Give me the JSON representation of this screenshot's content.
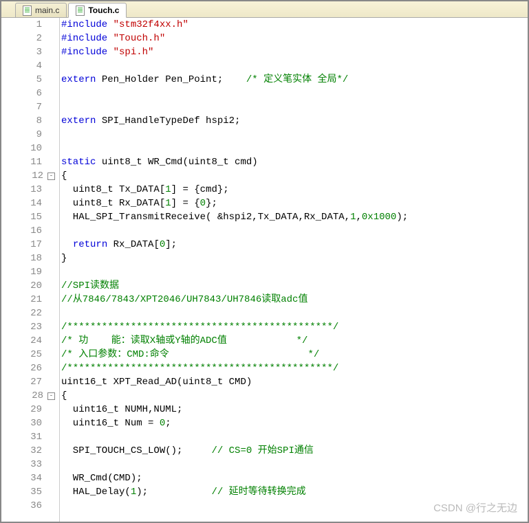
{
  "tabs": [
    {
      "name": "main.c",
      "active": false
    },
    {
      "name": "Touch.c",
      "active": true
    }
  ],
  "lines": [
    {
      "n": 1,
      "fold": null,
      "tokens": [
        [
          "kw",
          "#include "
        ],
        [
          "str",
          "\"stm32f4xx.h\""
        ]
      ]
    },
    {
      "n": 2,
      "fold": null,
      "tokens": [
        [
          "kw",
          "#include "
        ],
        [
          "str",
          "\"Touch.h\""
        ]
      ]
    },
    {
      "n": 3,
      "fold": null,
      "tokens": [
        [
          "kw",
          "#include "
        ],
        [
          "str",
          "\"spi.h\""
        ]
      ]
    },
    {
      "n": 4,
      "fold": null,
      "tokens": []
    },
    {
      "n": 5,
      "fold": null,
      "tokens": [
        [
          "kw",
          "extern"
        ],
        [
          "",
          " Pen_Holder Pen_Point;    "
        ],
        [
          "cmt",
          "/* 定义笔实体 全局*/"
        ]
      ]
    },
    {
      "n": 6,
      "fold": null,
      "tokens": []
    },
    {
      "n": 7,
      "fold": null,
      "tokens": []
    },
    {
      "n": 8,
      "fold": null,
      "tokens": [
        [
          "kw",
          "extern"
        ],
        [
          "",
          " SPI_HandleTypeDef hspi2;"
        ]
      ]
    },
    {
      "n": 9,
      "fold": null,
      "tokens": []
    },
    {
      "n": 10,
      "fold": null,
      "tokens": []
    },
    {
      "n": 11,
      "fold": null,
      "tokens": [
        [
          "kw",
          "static"
        ],
        [
          "",
          " uint8_t WR_Cmd(uint8_t cmd)"
        ]
      ]
    },
    {
      "n": 12,
      "fold": "-",
      "tokens": [
        [
          "",
          "{"
        ]
      ]
    },
    {
      "n": 13,
      "fold": null,
      "tokens": [
        [
          "",
          "  uint8_t Tx_DATA["
        ],
        [
          "num",
          "1"
        ],
        [
          "",
          "] = {cmd};"
        ]
      ]
    },
    {
      "n": 14,
      "fold": null,
      "tokens": [
        [
          "",
          "  uint8_t Rx_DATA["
        ],
        [
          "num",
          "1"
        ],
        [
          "",
          "] = {"
        ],
        [
          "num",
          "0"
        ],
        [
          "",
          "};"
        ]
      ]
    },
    {
      "n": 15,
      "fold": null,
      "tokens": [
        [
          "",
          "  HAL_SPI_TransmitReceive( &hspi2,Tx_DATA,Rx_DATA,"
        ],
        [
          "num",
          "1"
        ],
        [
          "",
          ","
        ],
        [
          "num",
          "0x1000"
        ],
        [
          "",
          ");"
        ]
      ]
    },
    {
      "n": 16,
      "fold": null,
      "tokens": []
    },
    {
      "n": 17,
      "fold": null,
      "tokens": [
        [
          "",
          "  "
        ],
        [
          "kw",
          "return"
        ],
        [
          "",
          " Rx_DATA["
        ],
        [
          "num",
          "0"
        ],
        [
          "",
          "];"
        ]
      ]
    },
    {
      "n": 18,
      "fold": null,
      "tokens": [
        [
          "",
          "}"
        ]
      ]
    },
    {
      "n": 19,
      "fold": null,
      "tokens": []
    },
    {
      "n": 20,
      "fold": null,
      "tokens": [
        [
          "cmt",
          "//SPI读数据"
        ]
      ]
    },
    {
      "n": 21,
      "fold": null,
      "tokens": [
        [
          "cmt",
          "//从7846/7843/XPT2046/UH7843/UH7846读取adc值"
        ]
      ]
    },
    {
      "n": 22,
      "fold": null,
      "tokens": []
    },
    {
      "n": 23,
      "fold": null,
      "tokens": [
        [
          "cmt",
          "/**********************************************/"
        ]
      ]
    },
    {
      "n": 24,
      "fold": null,
      "tokens": [
        [
          "cmt",
          "/* 功    能：读取X轴或Y轴的ADC值            */"
        ]
      ]
    },
    {
      "n": 25,
      "fold": null,
      "tokens": [
        [
          "cmt",
          "/* 入口参数：CMD:命令                        */"
        ]
      ]
    },
    {
      "n": 26,
      "fold": null,
      "tokens": [
        [
          "cmt",
          "/**********************************************/"
        ]
      ]
    },
    {
      "n": 27,
      "fold": null,
      "tokens": [
        [
          "",
          "uint16_t XPT_Read_AD(uint8_t CMD)"
        ]
      ]
    },
    {
      "n": 28,
      "fold": "-",
      "tokens": [
        [
          "",
          "{"
        ]
      ]
    },
    {
      "n": 29,
      "fold": null,
      "tokens": [
        [
          "",
          "  uint16_t NUMH,NUML;"
        ]
      ]
    },
    {
      "n": 30,
      "fold": null,
      "tokens": [
        [
          "",
          "  uint16_t Num = "
        ],
        [
          "num",
          "0"
        ],
        [
          "",
          ";"
        ]
      ]
    },
    {
      "n": 31,
      "fold": null,
      "tokens": []
    },
    {
      "n": 32,
      "fold": null,
      "tokens": [
        [
          "",
          "  SPI_TOUCH_CS_LOW();     "
        ],
        [
          "cmt",
          "// CS=0 开始SPI通信"
        ]
      ]
    },
    {
      "n": 33,
      "fold": null,
      "tokens": []
    },
    {
      "n": 34,
      "fold": null,
      "tokens": [
        [
          "",
          "  WR_Cmd(CMD);"
        ]
      ]
    },
    {
      "n": 35,
      "fold": null,
      "tokens": [
        [
          "",
          "  HAL_Delay("
        ],
        [
          "num",
          "1"
        ],
        [
          "",
          ");           "
        ],
        [
          "cmt",
          "// 延时等待转换完成"
        ]
      ]
    },
    {
      "n": 36,
      "fold": null,
      "tokens": []
    }
  ],
  "watermark": "CSDN @行之无边"
}
